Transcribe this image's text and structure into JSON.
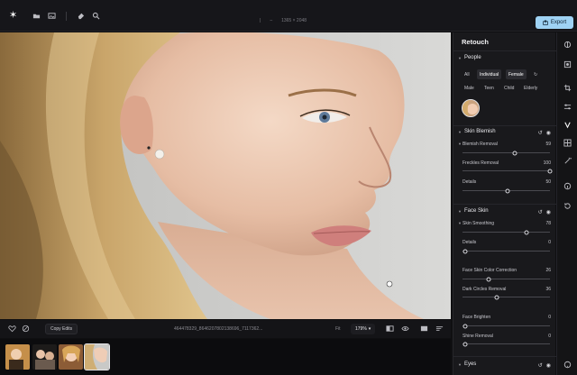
{
  "toolbar": {
    "logo": "✶",
    "center_sep": "|",
    "center_dash": "–",
    "dimensions": "1365 × 2048",
    "export_label": "Export"
  },
  "panel": {
    "title": "Retouch",
    "people": {
      "title": "People",
      "filters_row1": [
        {
          "label": "All",
          "selected": false
        },
        {
          "label": "Individual",
          "selected": true
        },
        {
          "label": "Female",
          "selected": true
        }
      ],
      "filters_row2": [
        {
          "label": "Male",
          "selected": false
        },
        {
          "label": "Teen",
          "selected": false
        },
        {
          "label": "Child",
          "selected": false
        },
        {
          "label": "Elderly",
          "selected": false
        }
      ]
    },
    "skin_blemish": {
      "title": "Skin Blemish",
      "sliders": [
        {
          "label": "Blemish Removal",
          "value": "59"
        },
        {
          "label": "Freckles Removal",
          "value": "100"
        },
        {
          "label": "Details",
          "value": "50"
        }
      ]
    },
    "face_skin": {
      "title": "Face Skin",
      "sliders": [
        {
          "label": "Skin Smoothing",
          "value": "78"
        },
        {
          "label": "Details",
          "value": "0"
        },
        {
          "label": "Face Skin Color Correction",
          "value": "26"
        },
        {
          "label": "Dark Circles Removal",
          "value": "36"
        },
        {
          "label": "Face Brighten",
          "value": "0"
        },
        {
          "label": "Shine Removal",
          "value": "0"
        }
      ]
    },
    "eyes": {
      "title": "Eyes"
    }
  },
  "bottombar": {
    "copy_edits": "Copy Edits",
    "filename": "464478329_8646207802138696_7117362...",
    "fit": "Fit",
    "zoom": "179%"
  },
  "filmstrip": {
    "selected_index": 3,
    "count": 4
  },
  "colors": {
    "accent": "#9fd2f4",
    "panel_bg": "#19191c",
    "app_bg": "#0f0f11"
  },
  "icons": {
    "toolbar": [
      "folder-icon",
      "image-icon",
      "eraser-icon",
      "search-icon"
    ],
    "rail": [
      "adjust-icon",
      "face-icon",
      "crop-icon",
      "sliders-icon",
      "retouch-icon",
      "grid-icon",
      "magic-icon",
      "info-icon",
      "history-icon",
      "help-icon"
    ],
    "bottom": [
      "heart-icon",
      "reject-icon",
      "compare-icon",
      "eye-icon",
      "gallery-icon",
      "menu-icon"
    ]
  }
}
